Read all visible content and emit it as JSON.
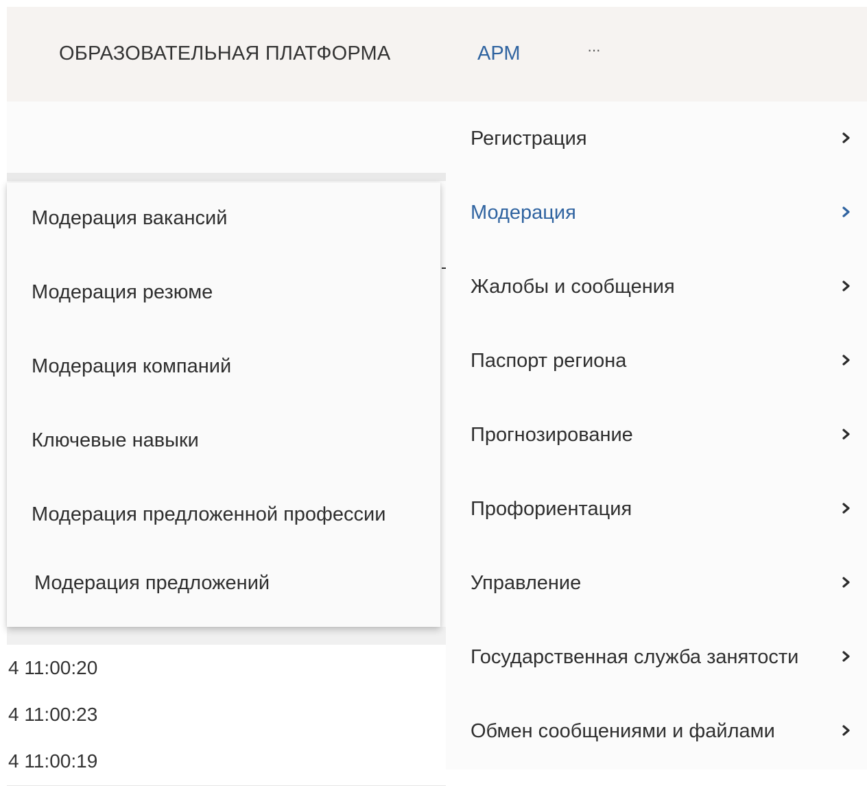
{
  "header": {
    "brand": "ОБРАЗОВАТЕЛЬНАЯ ПЛАТФОРМА",
    "arm_label": "АРМ",
    "more_label": "···"
  },
  "colors": {
    "accent": "#2f63a0",
    "topbar_bg": "#f6f3f1",
    "menu_bg": "#fbfbfb"
  },
  "main_menu": {
    "items": [
      {
        "label": "Регистрация",
        "icon": "chevron-right-icon"
      },
      {
        "label": "Модерация",
        "icon": "chevron-right-icon",
        "active": true
      },
      {
        "label": "Жалобы и сообщения",
        "icon": "chevron-right-icon"
      },
      {
        "label": "Паспорт региона",
        "icon": "chevron-right-icon"
      },
      {
        "label": "Прогнозирование",
        "icon": "chevron-right-icon"
      },
      {
        "label": "Профориентация",
        "icon": "chevron-right-icon"
      },
      {
        "label": "Управление",
        "icon": "chevron-right-icon"
      },
      {
        "label": "Государственная служба занятости",
        "icon": "chevron-right-icon"
      },
      {
        "label": "Обмен сообщениями и файлами",
        "icon": "chevron-right-icon"
      }
    ]
  },
  "submenu": {
    "items": [
      {
        "label": "Модерация вакансий"
      },
      {
        "label": "Модерация резюме"
      },
      {
        "label": "Модерация компаний"
      },
      {
        "label": "Ключевые навыки"
      },
      {
        "label": "Модерация предложенной профессии"
      },
      {
        "label": "Модерация предложений"
      }
    ]
  },
  "background_table": {
    "rows": [
      {
        "time": "4 11:00:20"
      },
      {
        "time": "4 11:00:23"
      },
      {
        "time": "4 11:00:19"
      }
    ]
  }
}
